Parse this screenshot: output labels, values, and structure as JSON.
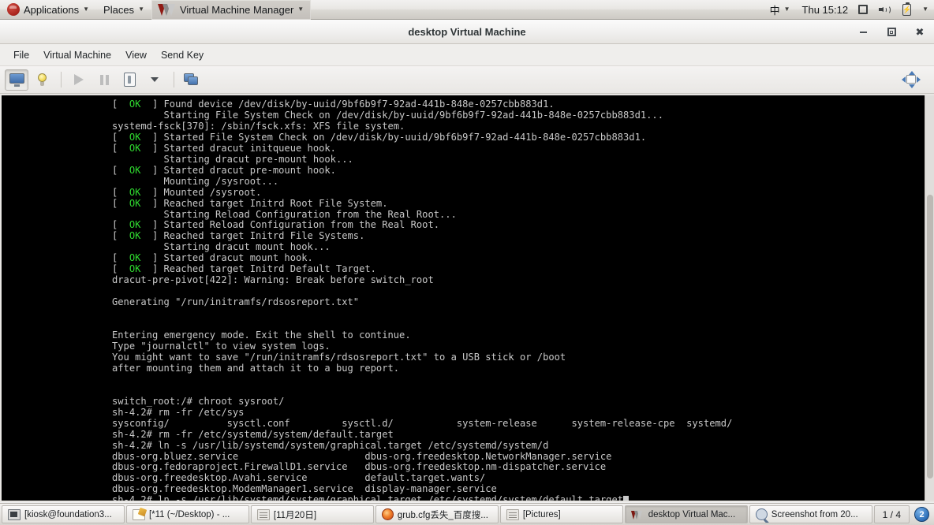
{
  "desktop_panel": {
    "logo_icon": "fedora-logo-icon",
    "menus": [
      {
        "label": "Applications",
        "icon": "fedora-logo-icon",
        "active": false
      },
      {
        "label": "Places",
        "icon": null,
        "active": false
      },
      {
        "label": "Virtual Machine Manager",
        "icon": "vmm-logo-icon",
        "active": true
      }
    ],
    "tray": {
      "input_method": "中",
      "clock": "Thu 15:12",
      "icons": [
        "display-icon",
        "volume-icon",
        "battery-icon",
        "tray-menu-caret-icon"
      ]
    }
  },
  "window": {
    "title": "desktop Virtual Machine",
    "controls": {
      "minimize": "minimize-icon",
      "maximize": "maximize-icon",
      "close": "close-icon"
    },
    "menubar": [
      "File",
      "Virtual Machine",
      "View",
      "Send Key"
    ],
    "toolbar": {
      "buttons": [
        {
          "name": "show-console-button",
          "icon": "monitor-icon",
          "pressed": true
        },
        {
          "name": "show-details-button",
          "icon": "lightbulb-icon",
          "pressed": false
        },
        {
          "name": "run-button",
          "icon": "play-icon",
          "pressed": false
        },
        {
          "name": "pause-button",
          "icon": "pause-icon",
          "pressed": false
        },
        {
          "name": "shutdown-button",
          "icon": "power-icon",
          "pressed": false
        },
        {
          "name": "shutdown-menu-button",
          "icon": "caret-down-icon",
          "pressed": false
        },
        {
          "name": "snapshots-button",
          "icon": "screens-icon",
          "pressed": false
        }
      ],
      "right_button": {
        "name": "fullscreen-button",
        "icon": "resize-arrows-icon"
      }
    }
  },
  "console": {
    "colors": {
      "background": "#000000",
      "foreground": "#c8c8c8",
      "ok": "#2fd92f"
    },
    "scrollbar": {
      "visible": true
    },
    "lines": [
      [
        {
          "t": "[ ",
          "c": ""
        },
        {
          "t": " OK ",
          "c": "ok"
        },
        {
          "t": " ] Found device /dev/disk/by-uuid/9bf6b9f7-92ad-441b-848e-0257cbb883d1.",
          "c": ""
        }
      ],
      [
        {
          "t": "         Starting File System Check on /dev/disk/by-uuid/9bf6b9f7-92ad-441b-848e-0257cbb883d1...",
          "c": ""
        }
      ],
      [
        {
          "t": "systemd-fsck[370]: /sbin/fsck.xfs: XFS file system.",
          "c": ""
        }
      ],
      [
        {
          "t": "[ ",
          "c": ""
        },
        {
          "t": " OK ",
          "c": "ok"
        },
        {
          "t": " ] Started File System Check on /dev/disk/by-uuid/9bf6b9f7-92ad-441b-848e-0257cbb883d1.",
          "c": ""
        }
      ],
      [
        {
          "t": "[ ",
          "c": ""
        },
        {
          "t": " OK ",
          "c": "ok"
        },
        {
          "t": " ] Started dracut initqueue hook.",
          "c": ""
        }
      ],
      [
        {
          "t": "         Starting dracut pre-mount hook...",
          "c": ""
        }
      ],
      [
        {
          "t": "[ ",
          "c": ""
        },
        {
          "t": " OK ",
          "c": "ok"
        },
        {
          "t": " ] Started dracut pre-mount hook.",
          "c": ""
        }
      ],
      [
        {
          "t": "         Mounting /sysroot...",
          "c": ""
        }
      ],
      [
        {
          "t": "[ ",
          "c": ""
        },
        {
          "t": " OK ",
          "c": "ok"
        },
        {
          "t": " ] Mounted /sysroot.",
          "c": ""
        }
      ],
      [
        {
          "t": "[ ",
          "c": ""
        },
        {
          "t": " OK ",
          "c": "ok"
        },
        {
          "t": " ] Reached target Initrd Root File System.",
          "c": ""
        }
      ],
      [
        {
          "t": "         Starting Reload Configuration from the Real Root...",
          "c": ""
        }
      ],
      [
        {
          "t": "[ ",
          "c": ""
        },
        {
          "t": " OK ",
          "c": "ok"
        },
        {
          "t": " ] Started Reload Configuration from the Real Root.",
          "c": ""
        }
      ],
      [
        {
          "t": "[ ",
          "c": ""
        },
        {
          "t": " OK ",
          "c": "ok"
        },
        {
          "t": " ] Reached target Initrd File Systems.",
          "c": ""
        }
      ],
      [
        {
          "t": "         Starting dracut mount hook...",
          "c": ""
        }
      ],
      [
        {
          "t": "[ ",
          "c": ""
        },
        {
          "t": " OK ",
          "c": "ok"
        },
        {
          "t": " ] Started dracut mount hook.",
          "c": ""
        }
      ],
      [
        {
          "t": "[ ",
          "c": ""
        },
        {
          "t": " OK ",
          "c": "ok"
        },
        {
          "t": " ] Reached target Initrd Default Target.",
          "c": ""
        }
      ],
      [
        {
          "t": "dracut-pre-pivot[422]: Warning: Break before switch_root",
          "c": ""
        }
      ],
      [
        {
          "t": "",
          "c": ""
        }
      ],
      [
        {
          "t": "Generating \"/run/initramfs/rdsosreport.txt\"",
          "c": ""
        }
      ],
      [
        {
          "t": "",
          "c": ""
        }
      ],
      [
        {
          "t": "",
          "c": ""
        }
      ],
      [
        {
          "t": "Entering emergency mode. Exit the shell to continue.",
          "c": ""
        }
      ],
      [
        {
          "t": "Type \"journalctl\" to view system logs.",
          "c": ""
        }
      ],
      [
        {
          "t": "You might want to save \"/run/initramfs/rdsosreport.txt\" to a USB stick or /boot",
          "c": ""
        }
      ],
      [
        {
          "t": "after mounting them and attach it to a bug report.",
          "c": ""
        }
      ],
      [
        {
          "t": "",
          "c": ""
        }
      ],
      [
        {
          "t": "",
          "c": ""
        }
      ],
      [
        {
          "t": "switch_root:/# chroot sysroot/",
          "c": ""
        }
      ],
      [
        {
          "t": "sh-4.2# rm -fr /etc/sys",
          "c": ""
        }
      ],
      [
        {
          "t": "sysconfig/          sysctl.conf         sysctl.d/           system-release      system-release-cpe  systemd/",
          "c": ""
        }
      ],
      [
        {
          "t": "sh-4.2# rm -fr /etc/systemd/system/default.target",
          "c": ""
        }
      ],
      [
        {
          "t": "sh-4.2# ln -s /usr/lib/systemd/system/graphical.target /etc/systemd/system/d",
          "c": ""
        }
      ],
      [
        {
          "t": "dbus-org.bluez.service                      dbus-org.freedesktop.NetworkManager.service",
          "c": ""
        }
      ],
      [
        {
          "t": "dbus-org.fedoraproject.FirewallD1.service   dbus-org.freedesktop.nm-dispatcher.service",
          "c": ""
        }
      ],
      [
        {
          "t": "dbus-org.freedesktop.Avahi.service          default.target.wants/",
          "c": ""
        }
      ],
      [
        {
          "t": "dbus-org.freedesktop.ModemManager1.service  display-manager.service",
          "c": ""
        }
      ],
      [
        {
          "t": "sh-4.2# ln -s /usr/lib/systemd/system/graphical.target /etc/systemd/system/default.target",
          "c": "",
          "cursor": true
        }
      ]
    ]
  },
  "taskbar": {
    "tasks": [
      {
        "label": "[kiosk@foundation3...",
        "icon": "terminal-icon",
        "active": false
      },
      {
        "label": "[*11 (~/Desktop) - ...",
        "icon": "text-editor-icon",
        "active": false
      },
      {
        "label": "[11月20日]",
        "icon": "file-manager-icon",
        "active": false
      },
      {
        "label": "grub.cfg丢失_百度搜...",
        "icon": "firefox-icon",
        "active": false
      },
      {
        "label": "[Pictures]",
        "icon": "file-manager-icon",
        "active": false
      },
      {
        "label": "desktop Virtual Mac...",
        "icon": "vmm-logo-icon",
        "active": true
      },
      {
        "label": "Screenshot from 20...",
        "icon": "screenshot-icon",
        "active": false
      }
    ],
    "workspace_pager": "1 / 4",
    "notification_count": "2"
  }
}
